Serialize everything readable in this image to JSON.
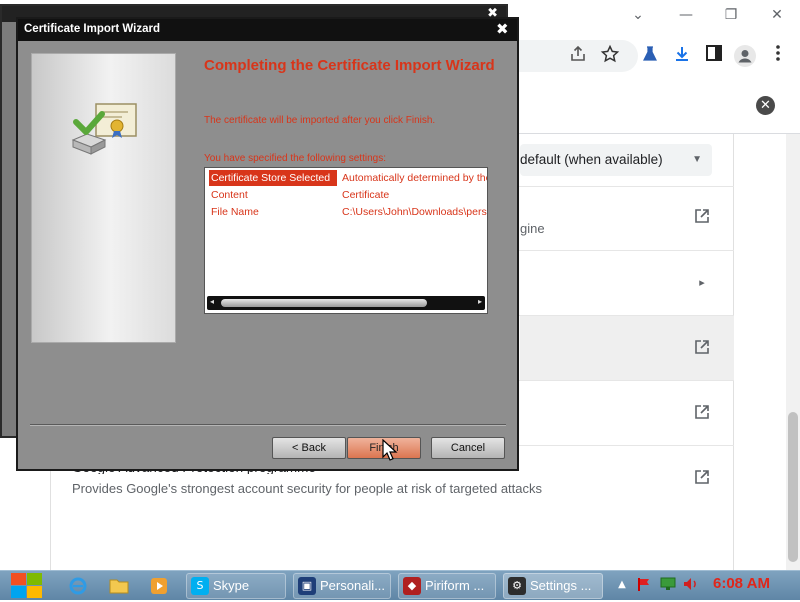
{
  "chrome": {
    "window_controls": {
      "chevron": "⌄",
      "minimize": "—",
      "restore": "❐",
      "close": "✕"
    },
    "toolbar_icons": [
      "share-icon",
      "bookmark-star-icon",
      "lab-flask-icon",
      "download-icon",
      "side-panel-icon",
      "profile-icon",
      "more-menu-icon"
    ],
    "close_search_glyph": "✕",
    "dns_select": {
      "value": "default (when available)",
      "arrow": "▼"
    },
    "engine_fragment": "gine",
    "rows": [
      {
        "icon": "external-link-icon",
        "glyph": "⧉"
      },
      {
        "icon": "chevron-right-icon",
        "glyph": "▸"
      },
      {
        "icon": "external-link-icon",
        "glyph": "⧉"
      },
      {
        "icon": "external-link-icon",
        "glyph": "⧉"
      },
      {
        "icon": "external-link-icon",
        "glyph": "⧉"
      }
    ],
    "gap_title": "Google Advanced Protection programme",
    "gap_description": "Provides Google's strongest account security for people at risk of targeted attacks"
  },
  "back_window": {
    "close": "✖"
  },
  "wizard": {
    "title": "Certificate Import Wizard",
    "close": "✖",
    "heading": "Completing the Certificate Import Wizard",
    "info": "The certificate will be imported after you click Finish.",
    "specified_label": "You have specified the following settings:",
    "settings": [
      {
        "key": "Certificate Store Selected",
        "value": "Automatically determined by the wizard"
      },
      {
        "key": "Content",
        "value": "Certificate"
      },
      {
        "key": "File Name",
        "value": "C:\\Users\\John\\Downloads\\personal.cer"
      }
    ],
    "buttons": {
      "back": "< Back",
      "finish": "Finish",
      "cancel": "Cancel"
    }
  },
  "taskbar": {
    "tasks": [
      {
        "label": "Skype"
      },
      {
        "label": "Personali..."
      },
      {
        "label": "Piriform ..."
      },
      {
        "label": "Settings ..."
      }
    ],
    "clock": "6:08 AM"
  },
  "colors": {
    "accent": "#d8351a",
    "taskbar": "#6f95b3",
    "clock": "#e0261b"
  }
}
